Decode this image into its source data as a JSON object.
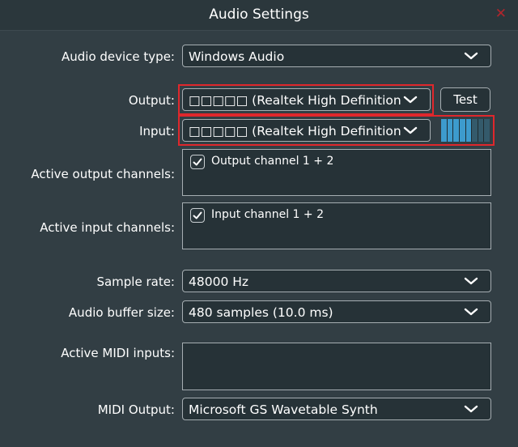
{
  "window": {
    "title": "Audio Settings",
    "close_glyph": "✕"
  },
  "device_type": {
    "label": "Audio device type:",
    "value": "Windows Audio"
  },
  "output": {
    "label": "Output:",
    "value": "□□□□□ (Realtek High Definition Audio...",
    "test_label": "Test"
  },
  "input": {
    "label": "Input:",
    "value": "□□□□□ (Realtek High Definition Audio...",
    "level_meter": {
      "active_segments": 5,
      "total_segments": 8,
      "active_color": "#3d9bcd",
      "inactive_color": "#345a6b"
    }
  },
  "output_channels": {
    "label": "Active output channels:",
    "items": [
      {
        "label": "Output channel 1 + 2",
        "checked": true
      }
    ]
  },
  "input_channels": {
    "label": "Active input channels:",
    "items": [
      {
        "label": "Input channel 1 + 2",
        "checked": true
      }
    ]
  },
  "sample_rate": {
    "label": "Sample rate:",
    "value": "48000 Hz"
  },
  "buffer_size": {
    "label": "Audio buffer size:",
    "value": "480 samples (10.0 ms)"
  },
  "midi_inputs": {
    "label": "Active MIDI inputs:"
  },
  "midi_output": {
    "label": "MIDI Output:",
    "value": "Microsoft GS Wavetable Synth"
  },
  "colors": {
    "background": "#323e44",
    "field": "#263237",
    "highlight_border": "#e0272c",
    "close": "#b0252c"
  }
}
